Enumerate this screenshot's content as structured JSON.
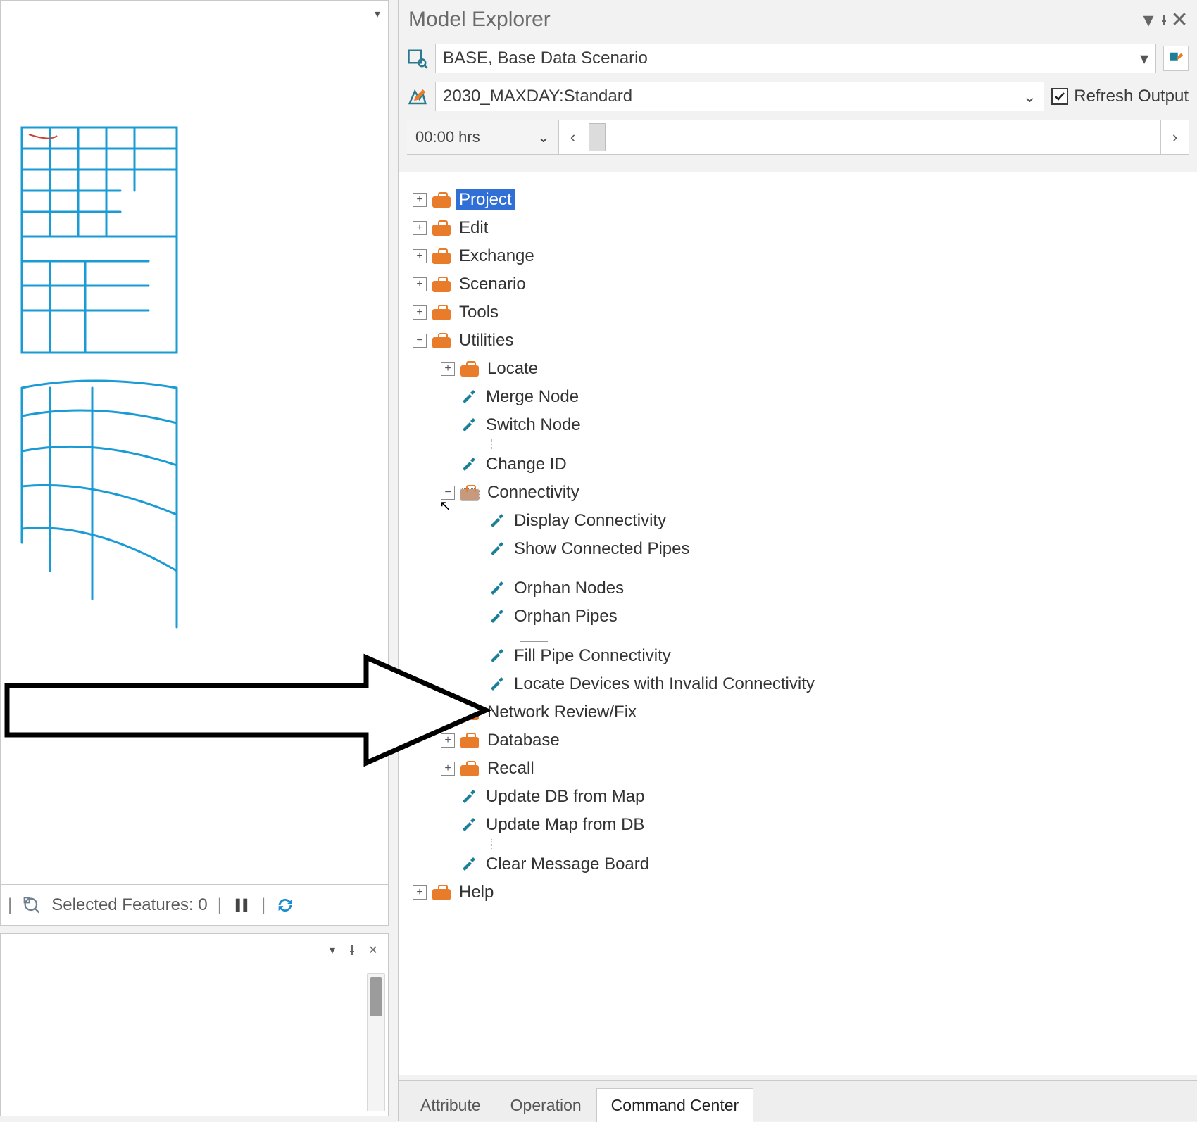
{
  "left_panel": {
    "selected_features_label": "Selected Features: 0"
  },
  "explorer": {
    "title": "Model Explorer",
    "scenario_value": "BASE, Base Data Scenario",
    "profile_value": "2030_MAXDAY:Standard",
    "refresh_label": "Refresh Output",
    "refresh_checked": true,
    "time_value": "00:00 hrs"
  },
  "tree": {
    "project": "Project",
    "edit": "Edit",
    "exchange": "Exchange",
    "scenario": "Scenario",
    "tools": "Tools",
    "utilities": "Utilities",
    "locate": "Locate",
    "merge_node": "Merge Node",
    "switch_node": "Switch Node",
    "change_id": "Change ID",
    "connectivity": "Connectivity",
    "display_connectivity": "Display Connectivity",
    "show_connected_pipes": "Show Connected Pipes",
    "orphan_nodes": "Orphan Nodes",
    "orphan_pipes": "Orphan Pipes",
    "fill_pipe_connectivity": "Fill Pipe Connectivity",
    "locate_invalid": "Locate Devices with Invalid Connectivity",
    "network_review": "Network Review/Fix",
    "database": "Database",
    "recall": "Recall",
    "update_db": "Update DB from Map",
    "update_map": "Update Map from DB",
    "clear_msg": "Clear Message Board",
    "help": "Help"
  },
  "tabs": {
    "attribute": "Attribute",
    "operation": "Operation",
    "command_center": "Command Center"
  }
}
